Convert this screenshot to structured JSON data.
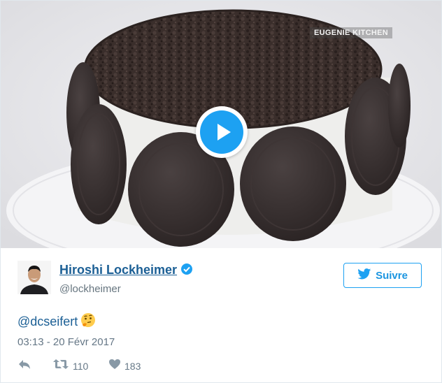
{
  "media": {
    "watermark": "EUGENIE KITCHEN",
    "play_icon": "play-icon"
  },
  "user": {
    "display_name": "Hiroshi Lockheimer",
    "handle": "@lockheimer",
    "verified_icon": "verified-badge-icon"
  },
  "follow": {
    "label": "Suivre",
    "icon": "twitter-bird-icon",
    "color": "#1da1f2"
  },
  "tweet": {
    "mention": "@dcseifert",
    "emoji_icon": "thinking-face-emoji",
    "timestamp": "03:13 - 20 Févr 2017"
  },
  "actions": {
    "reply_icon": "reply-icon",
    "retweet_icon": "retweet-icon",
    "retweet_count": "110",
    "like_icon": "heart-icon",
    "like_count": "183"
  },
  "colors": {
    "link": "#1b5f95",
    "accent": "#1da1f2",
    "secondary_text": "#657786"
  }
}
